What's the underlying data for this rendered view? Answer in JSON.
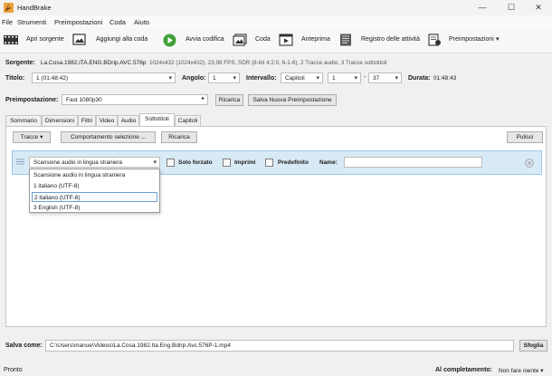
{
  "window": {
    "title": "HandBrake",
    "minimize": "—",
    "maximize": "☐",
    "close": "✕"
  },
  "menu": [
    "File",
    "Strumenti",
    "Preimpostazioni",
    "Coda",
    "Aiuto"
  ],
  "toolbar": {
    "open_source": "Apri sorgente",
    "add_queue": "Aggiungi alla coda",
    "start_encode": "Avvia codifica",
    "queue": "Coda",
    "preview": "Anteprima",
    "activity_log": "Registro delle attività",
    "presets": "Preimpostazioni"
  },
  "source": {
    "label": "Sorgente:",
    "name": "La.Cosa.1982.iTA.ENG.BDrip.AVC.576p",
    "info": "1024x432 (1024x432), 23,98 FPS, SDR (8-bit 4:2:0, 6-1-6), 2 Tracce audio, 3 Tracce sottotitoli"
  },
  "title_row": {
    "title_label": "Titolo:",
    "title_value": "1 (01:48:42)",
    "angle_label": "Angolo:",
    "angle_value": "1",
    "range_label": "Intervallo:",
    "range_mode": "Capitoli",
    "range_start": "1",
    "range_sep": "-",
    "range_end": "37",
    "duration_label": "Durata:",
    "duration_value": "01:48:43"
  },
  "preset_row": {
    "label": "Preimpostazione:",
    "value": "Fast 1080p30",
    "reload": "Ricarica",
    "save_new": "Salva Nuova Preimpostazione"
  },
  "tabs": [
    "Sommario",
    "Dimensioni",
    "Filtri",
    "Video",
    "Audio",
    "Sottotitoli",
    "Capitoli"
  ],
  "subtitles": {
    "tracks_button": "Tracce",
    "behavior_button": "Comportamento selezione ...",
    "reload_button": "Ricarica",
    "clear_button": "Pulisci",
    "track_select": "Scansione audio in lingua straniera",
    "forced_label": "Solo forzato",
    "burn_label": "Imprimi",
    "default_label": "Predefinito",
    "name_label": "Name:",
    "name_value": "",
    "options": [
      "Scansione audio in lingua straniera",
      "1 italiano (UTF-8)",
      "2 italiano (UTF-8)",
      "3 English (UTF-8)"
    ]
  },
  "save_row": {
    "label": "Salva come:",
    "path": "C:\\Users\\manue\\Videos\\La.Cosa.1982.Ita.Eng.Bdrip.Avc.576P-1.mp4",
    "browse": "Sfoglia"
  },
  "status": {
    "text": "Pronto",
    "done_label": "Al completamento:",
    "done_value": "Non fare niente ▾"
  },
  "colors": {
    "accent": "#0078d4",
    "selection_row": "#d9eaf7",
    "start_green": "#3fa037"
  }
}
